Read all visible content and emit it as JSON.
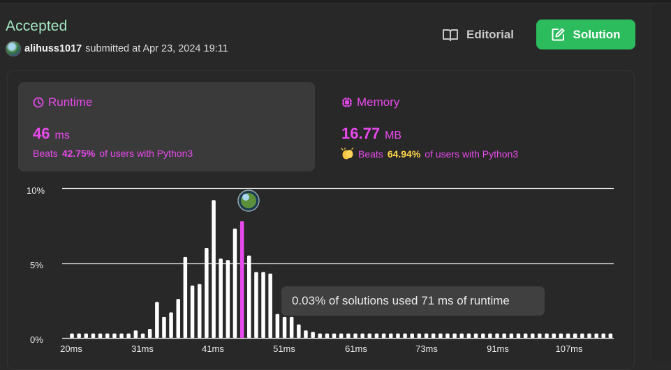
{
  "status": "Accepted",
  "submitter": {
    "username": "alihuss1017",
    "text": "submitted at Apr 23, 2024 19:11"
  },
  "actions": {
    "editorial_label": "Editorial",
    "solution_label": "Solution"
  },
  "runtime": {
    "title": "Runtime",
    "value": "46",
    "unit": "ms",
    "beats_prefix": "Beats",
    "beats_pct": "42.75%",
    "beats_suffix": "of users with Python3"
  },
  "memory": {
    "title": "Memory",
    "value": "16.77",
    "unit": "MB",
    "beats_prefix": "Beats",
    "beats_pct": "64.94%",
    "beats_suffix": "of users with Python3"
  },
  "colors": {
    "accent": "#e84aec",
    "success": "#2cbb5d",
    "accepted": "#a3e6c1",
    "highlight": "#ffd64a"
  },
  "tooltip": "0.03% of solutions used 71 ms of runtime",
  "chart_data": {
    "type": "bar",
    "ylabels": [
      "10%",
      "5%",
      "0%"
    ],
    "ylim": [
      0,
      10
    ],
    "grid": true,
    "xlabels": [
      "20ms",
      "31ms",
      "41ms",
      "51ms",
      "61ms",
      "73ms",
      "91ms",
      "107ms"
    ],
    "values": [
      0.3,
      0.3,
      0.3,
      0.3,
      0.3,
      0.3,
      0.3,
      0.3,
      0.3,
      0.5,
      0.3,
      0.6,
      2.4,
      1.4,
      1.7,
      2.6,
      5.4,
      3.5,
      3.6,
      6.0,
      9.2,
      5.3,
      5.2,
      7.3,
      7.8,
      5.5,
      4.4,
      4.4,
      4.3,
      1.6,
      1.4,
      1.4,
      0.9,
      0.5,
      0.4,
      0.3,
      0.3,
      0.3,
      0.3,
      0.3,
      0.3,
      0.3,
      0.3,
      0.3,
      0.3,
      0.3,
      0.3,
      0.3,
      0.3,
      0.3,
      0.3,
      0.3,
      0.3,
      0.3,
      0.3,
      0.3,
      0.3,
      0.3,
      0.3,
      0.3,
      0.3,
      0.3,
      0.3,
      0.3,
      0.3,
      0.3,
      0.3,
      0.3,
      0.3,
      0.3,
      0.3,
      0.3,
      0.3,
      0.3,
      0.3,
      0.3,
      0.3
    ],
    "highlight_index": 24,
    "highlight_color": "#e84aec",
    "bar_color": "#ffffff"
  }
}
